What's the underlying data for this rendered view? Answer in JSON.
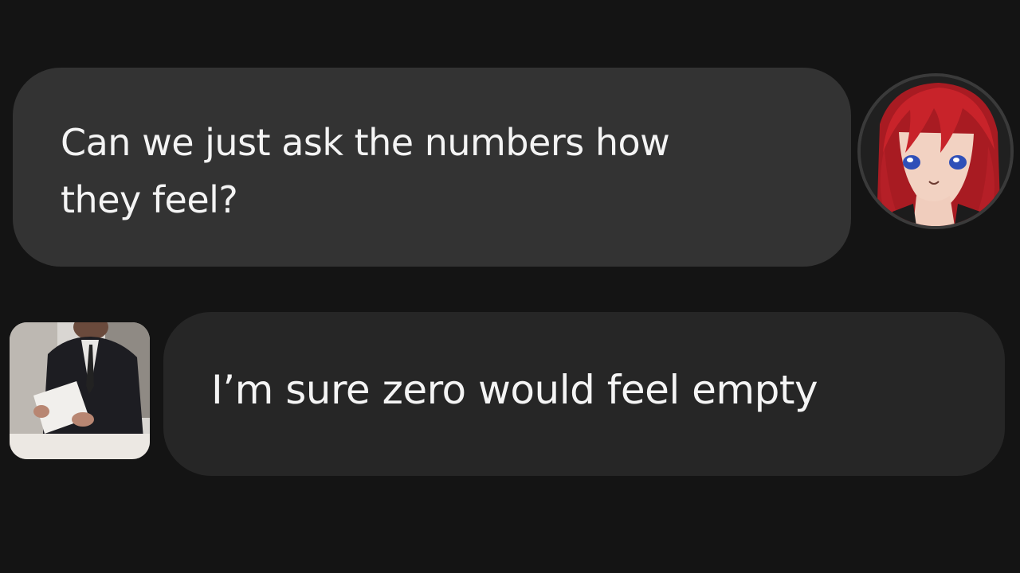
{
  "conversation": {
    "messages": [
      {
        "sender": "user",
        "text_line1": "Can we just ask the numbers how",
        "text_line2": "they feel?",
        "avatar": "anime-girl-red-hair-avatar"
      },
      {
        "sender": "assistant",
        "text": "I’m sure zero would feel empty",
        "avatar": "businessman-suit-photo-avatar"
      }
    ]
  },
  "colors": {
    "background": "#141414",
    "bubble_user": "#333333",
    "bubble_assistant": "#262626",
    "text": "#f4f4f4",
    "hair_red": "#c8232a"
  }
}
